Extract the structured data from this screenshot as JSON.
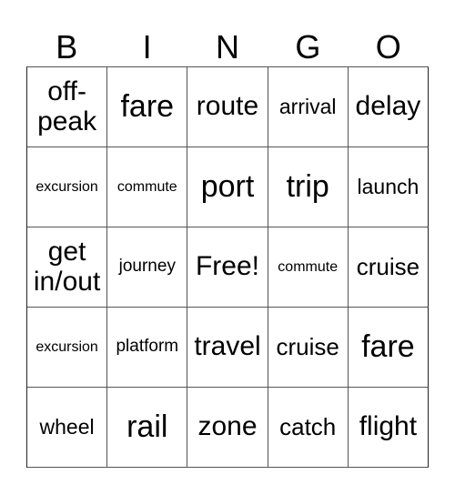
{
  "header": {
    "letters": [
      "B",
      "I",
      "N",
      "G",
      "O"
    ]
  },
  "cells": [
    {
      "text": "off-peak",
      "size": "s-l"
    },
    {
      "text": "fare",
      "size": "s-xl"
    },
    {
      "text": "route",
      "size": "s-l"
    },
    {
      "text": "arrival",
      "size": "s-sm"
    },
    {
      "text": "delay",
      "size": "s-l"
    },
    {
      "text": "excursion",
      "size": "s-xs"
    },
    {
      "text": "commute",
      "size": "s-xs"
    },
    {
      "text": "port",
      "size": "s-xl"
    },
    {
      "text": "trip",
      "size": "s-xl"
    },
    {
      "text": "launch",
      "size": "s-sm"
    },
    {
      "text": "get in/out",
      "size": "s-l"
    },
    {
      "text": "journey",
      "size": "s-s"
    },
    {
      "text": "Free!",
      "size": "s-l"
    },
    {
      "text": "commute",
      "size": "s-xs"
    },
    {
      "text": "cruise",
      "size": "s-m"
    },
    {
      "text": "excursion",
      "size": "s-xs"
    },
    {
      "text": "platform",
      "size": "s-s"
    },
    {
      "text": "travel",
      "size": "s-l"
    },
    {
      "text": "cruise",
      "size": "s-m"
    },
    {
      "text": "fare",
      "size": "s-xl"
    },
    {
      "text": "wheel",
      "size": "s-sm"
    },
    {
      "text": "rail",
      "size": "s-xl"
    },
    {
      "text": "zone",
      "size": "s-l"
    },
    {
      "text": "catch",
      "size": "s-m"
    },
    {
      "text": "flight",
      "size": "s-l"
    }
  ]
}
